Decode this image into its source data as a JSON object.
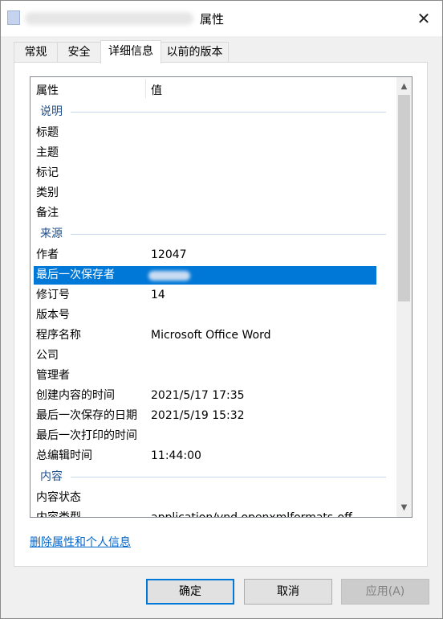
{
  "window": {
    "title_suffix": "属性"
  },
  "tabs": [
    "常规",
    "安全",
    "详细信息",
    "以前的版本"
  ],
  "active_tab": 2,
  "list": {
    "col_property": "属性",
    "col_value": "值",
    "groups": [
      {
        "name": "说明",
        "rows": [
          {
            "k": "标题",
            "v": ""
          },
          {
            "k": "主题",
            "v": ""
          },
          {
            "k": "标记",
            "v": ""
          },
          {
            "k": "类别",
            "v": ""
          },
          {
            "k": "备注",
            "v": ""
          }
        ]
      },
      {
        "name": "来源",
        "rows": [
          {
            "k": "作者",
            "v": "12047"
          },
          {
            "k": "最后一次保存者",
            "v": "",
            "selected": true,
            "blurred": true
          },
          {
            "k": "修订号",
            "v": "14"
          },
          {
            "k": "版本号",
            "v": ""
          },
          {
            "k": "程序名称",
            "v": "Microsoft Office Word"
          },
          {
            "k": "公司",
            "v": ""
          },
          {
            "k": "管理者",
            "v": ""
          },
          {
            "k": "创建内容的时间",
            "v": "2021/5/17 17:35"
          },
          {
            "k": "最后一次保存的日期",
            "v": "2021/5/19 15:32"
          },
          {
            "k": "最后一次打印的时间",
            "v": ""
          },
          {
            "k": "总编辑时间",
            "v": "11:44:00"
          }
        ]
      },
      {
        "name": "内容",
        "rows": [
          {
            "k": "内容状态",
            "v": ""
          },
          {
            "k": "内容类型",
            "v": "application/vnd.openxmlformats-off"
          }
        ]
      }
    ]
  },
  "remove_link": "删除属性和个人信息",
  "buttons": {
    "ok": "确定",
    "cancel": "取消",
    "apply": "应用(A)"
  }
}
